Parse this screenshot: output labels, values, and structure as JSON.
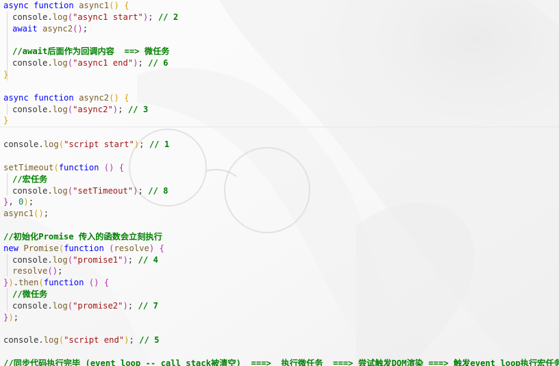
{
  "editor": {
    "lines": [
      {
        "indent": 0,
        "tokens": [
          {
            "t": "async",
            "c": "kw"
          },
          {
            "t": " ",
            "c": "tx"
          },
          {
            "t": "function",
            "c": "kw"
          },
          {
            "t": " ",
            "c": "tx"
          },
          {
            "t": "async1",
            "c": "fn"
          },
          {
            "t": "()",
            "c": "b1"
          },
          {
            "t": " ",
            "c": "tx"
          },
          {
            "t": "{",
            "c": "b1"
          }
        ]
      },
      {
        "indent": 1,
        "tokens": [
          {
            "t": "console",
            "c": "tx"
          },
          {
            "t": ".",
            "c": "tx"
          },
          {
            "t": "log",
            "c": "fn"
          },
          {
            "t": "(",
            "c": "b2"
          },
          {
            "t": "\"async1 start\"",
            "c": "str"
          },
          {
            "t": ")",
            "c": "b2"
          },
          {
            "t": "; ",
            "c": "tx"
          },
          {
            "t": "// 2",
            "c": "cm"
          }
        ]
      },
      {
        "indent": 1,
        "tokens": [
          {
            "t": "await",
            "c": "kw"
          },
          {
            "t": " ",
            "c": "tx"
          },
          {
            "t": "async2",
            "c": "fn"
          },
          {
            "t": "()",
            "c": "b2"
          },
          {
            "t": ";",
            "c": "tx"
          }
        ]
      },
      {
        "indent": 0,
        "tokens": []
      },
      {
        "indent": 1,
        "tokens": [
          {
            "t": "//await后面作为回调内容  ==> 微任务",
            "c": "cm"
          }
        ]
      },
      {
        "indent": 1,
        "tokens": [
          {
            "t": "console",
            "c": "tx"
          },
          {
            "t": ".",
            "c": "tx"
          },
          {
            "t": "log",
            "c": "fn"
          },
          {
            "t": "(",
            "c": "b2"
          },
          {
            "t": "\"async1 end\"",
            "c": "str"
          },
          {
            "t": ")",
            "c": "b2"
          },
          {
            "t": "; ",
            "c": "tx"
          },
          {
            "t": "// 6",
            "c": "cm"
          }
        ]
      },
      {
        "indent": 0,
        "tokens": [
          {
            "t": "}",
            "c": "b1"
          }
        ]
      },
      {
        "indent": 0,
        "tokens": []
      },
      {
        "indent": 0,
        "tokens": [
          {
            "t": "async",
            "c": "kw"
          },
          {
            "t": " ",
            "c": "tx"
          },
          {
            "t": "function",
            "c": "kw"
          },
          {
            "t": " ",
            "c": "tx"
          },
          {
            "t": "async2",
            "c": "fn"
          },
          {
            "t": "()",
            "c": "b1"
          },
          {
            "t": " ",
            "c": "tx"
          },
          {
            "t": "{",
            "c": "b1"
          }
        ]
      },
      {
        "indent": 1,
        "tokens": [
          {
            "t": "console",
            "c": "tx"
          },
          {
            "t": ".",
            "c": "tx"
          },
          {
            "t": "log",
            "c": "fn"
          },
          {
            "t": "(",
            "c": "b2"
          },
          {
            "t": "\"async2\"",
            "c": "str"
          },
          {
            "t": ")",
            "c": "b2"
          },
          {
            "t": "; ",
            "c": "tx"
          },
          {
            "t": "// 3",
            "c": "cm"
          }
        ]
      },
      {
        "indent": 0,
        "tokens": [
          {
            "t": "}",
            "c": "b1"
          }
        ]
      },
      {
        "indent": 0,
        "tokens": []
      },
      {
        "indent": 0,
        "tokens": [
          {
            "t": "console",
            "c": "tx"
          },
          {
            "t": ".",
            "c": "tx"
          },
          {
            "t": "log",
            "c": "fn"
          },
          {
            "t": "(",
            "c": "b1"
          },
          {
            "t": "\"script start\"",
            "c": "str"
          },
          {
            "t": ")",
            "c": "b1"
          },
          {
            "t": "; ",
            "c": "tx"
          },
          {
            "t": "// 1",
            "c": "cm"
          }
        ]
      },
      {
        "indent": 0,
        "tokens": []
      },
      {
        "indent": 0,
        "tokens": [
          {
            "t": "setTimeout",
            "c": "fn"
          },
          {
            "t": "(",
            "c": "b1"
          },
          {
            "t": "function",
            "c": "kw"
          },
          {
            "t": " ",
            "c": "tx"
          },
          {
            "t": "()",
            "c": "b2"
          },
          {
            "t": " ",
            "c": "tx"
          },
          {
            "t": "{",
            "c": "b2"
          }
        ]
      },
      {
        "indent": 1,
        "tokens": [
          {
            "t": "//宏任务",
            "c": "cm"
          }
        ]
      },
      {
        "indent": 1,
        "tokens": [
          {
            "t": "console",
            "c": "tx"
          },
          {
            "t": ".",
            "c": "tx"
          },
          {
            "t": "log",
            "c": "fn"
          },
          {
            "t": "(",
            "c": "b2"
          },
          {
            "t": "\"setTimeout\"",
            "c": "str"
          },
          {
            "t": ")",
            "c": "b2"
          },
          {
            "t": "; ",
            "c": "tx"
          },
          {
            "t": "// 8",
            "c": "cm"
          }
        ]
      },
      {
        "indent": 0,
        "tokens": [
          {
            "t": "}",
            "c": "b2"
          },
          {
            "t": ", ",
            "c": "tx"
          },
          {
            "t": "0",
            "c": "num"
          },
          {
            "t": ")",
            "c": "b1"
          },
          {
            "t": ";",
            "c": "tx"
          }
        ]
      },
      {
        "indent": 0,
        "tokens": [
          {
            "t": "async1",
            "c": "fn"
          },
          {
            "t": "()",
            "c": "b1"
          },
          {
            "t": ";",
            "c": "tx"
          }
        ]
      },
      {
        "indent": 0,
        "tokens": []
      },
      {
        "indent": 0,
        "tokens": [
          {
            "t": "//初始化Promise 传入的函数会立刻执行",
            "c": "cm"
          }
        ]
      },
      {
        "indent": 0,
        "tokens": [
          {
            "t": "new",
            "c": "kw"
          },
          {
            "t": " ",
            "c": "tx"
          },
          {
            "t": "Promise",
            "c": "fn"
          },
          {
            "t": "(",
            "c": "b1"
          },
          {
            "t": "function",
            "c": "kw"
          },
          {
            "t": " ",
            "c": "tx"
          },
          {
            "t": "(",
            "c": "b2"
          },
          {
            "t": "resolve",
            "c": "fn"
          },
          {
            "t": ")",
            "c": "b2"
          },
          {
            "t": " ",
            "c": "tx"
          },
          {
            "t": "{",
            "c": "b2"
          }
        ]
      },
      {
        "indent": 1,
        "tokens": [
          {
            "t": "console",
            "c": "tx"
          },
          {
            "t": ".",
            "c": "tx"
          },
          {
            "t": "log",
            "c": "fn"
          },
          {
            "t": "(",
            "c": "b2"
          },
          {
            "t": "\"promise1\"",
            "c": "str"
          },
          {
            "t": ")",
            "c": "b2"
          },
          {
            "t": "; ",
            "c": "tx"
          },
          {
            "t": "// 4",
            "c": "cm"
          }
        ]
      },
      {
        "indent": 1,
        "tokens": [
          {
            "t": "resolve",
            "c": "fn"
          },
          {
            "t": "()",
            "c": "b2"
          },
          {
            "t": ";",
            "c": "tx"
          }
        ]
      },
      {
        "indent": 0,
        "tokens": [
          {
            "t": "}",
            "c": "b2"
          },
          {
            "t": ")",
            "c": "b1"
          },
          {
            "t": ".",
            "c": "tx"
          },
          {
            "t": "then",
            "c": "fn"
          },
          {
            "t": "(",
            "c": "b1"
          },
          {
            "t": "function",
            "c": "kw"
          },
          {
            "t": " ",
            "c": "tx"
          },
          {
            "t": "()",
            "c": "b2"
          },
          {
            "t": " ",
            "c": "tx"
          },
          {
            "t": "{",
            "c": "b2"
          }
        ]
      },
      {
        "indent": 1,
        "tokens": [
          {
            "t": "//微任务",
            "c": "cm"
          }
        ]
      },
      {
        "indent": 1,
        "tokens": [
          {
            "t": "console",
            "c": "tx"
          },
          {
            "t": ".",
            "c": "tx"
          },
          {
            "t": "log",
            "c": "fn"
          },
          {
            "t": "(",
            "c": "b2"
          },
          {
            "t": "\"promise2\"",
            "c": "str"
          },
          {
            "t": ")",
            "c": "b2"
          },
          {
            "t": "; ",
            "c": "tx"
          },
          {
            "t": "// 7",
            "c": "cm"
          }
        ]
      },
      {
        "indent": 0,
        "tokens": [
          {
            "t": "}",
            "c": "b2"
          },
          {
            "t": ")",
            "c": "b1"
          },
          {
            "t": ";",
            "c": "tx"
          }
        ]
      },
      {
        "indent": 0,
        "tokens": []
      },
      {
        "indent": 0,
        "tokens": [
          {
            "t": "console",
            "c": "tx"
          },
          {
            "t": ".",
            "c": "tx"
          },
          {
            "t": "log",
            "c": "fn"
          },
          {
            "t": "(",
            "c": "b1"
          },
          {
            "t": "\"script end\"",
            "c": "str"
          },
          {
            "t": ")",
            "c": "b1"
          },
          {
            "t": "; ",
            "c": "tx"
          },
          {
            "t": "// 5",
            "c": "cm"
          }
        ]
      },
      {
        "indent": 0,
        "tokens": []
      },
      {
        "indent": 0,
        "tokens": [
          {
            "t": "//同步代码执行完毕 (event loop -- call stack被清空)  ===>  执行微任务  ===> 尝试触发DOM渲染 ===> 触发event loop执行宏任务",
            "c": "cm"
          }
        ]
      }
    ]
  },
  "colors": {
    "keyword": "#0000ff",
    "function": "#795e26",
    "string": "#a31515",
    "comment": "#008000",
    "number": "#098658",
    "bracket_outer": "#d4a106",
    "bracket_inner": "#b02cb5",
    "background": "#fbfbfb"
  }
}
